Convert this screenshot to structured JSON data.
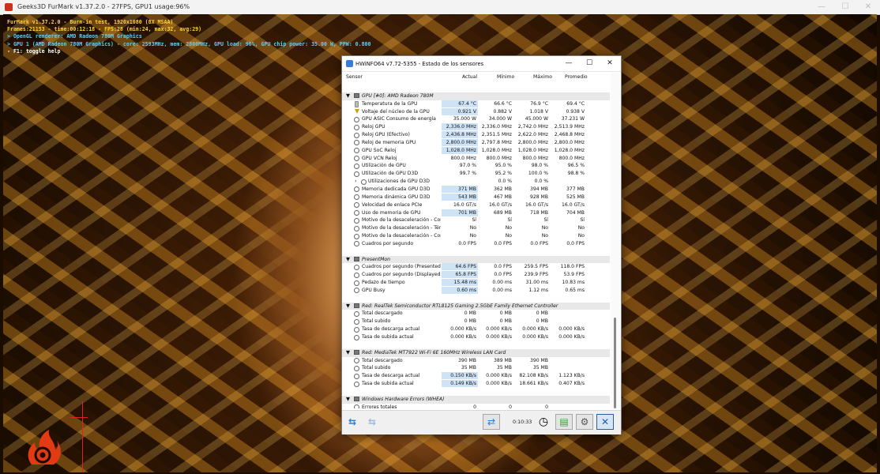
{
  "furmark": {
    "window_title": "Geeks3D FurMark v1.37.2.0 - 27FPS, GPU1 usage:96%",
    "overlay": {
      "line1": "FurMark v1.37.2.0 - Burn-in test, 1920x1080 (8X MSAA)",
      "line2": "Frames:21153 - time:00:12:18 - FPS:28 (min:24, max:32, avg:29)",
      "line3": "> OpenGL renderer: AMD Radeon 780M Graphics",
      "line4": "> GPU 1 (AMD Radeon 780M Graphics) - core: 2593MHz, mem: 2800MHz, GPU load: 96%, GPU chip power: 35.00 W, PPW: 0.800",
      "line5": "- F1: toggle help"
    },
    "window_buttons": {
      "minimize": "—",
      "maximize": "☐",
      "close": "✕"
    },
    "colors": {
      "overlay_yellow": "#ffd23a",
      "overlay_cyan": "#54d3ff"
    }
  },
  "hwinfo": {
    "window_title": "HWiNFO64 v7.72-5355 - Estado de los sensores",
    "window_buttons": {
      "minimize": "—",
      "maximize": "☐",
      "close": "✕"
    },
    "columns": {
      "sensor": "Sensor",
      "current": "Actual",
      "min": "Mínimo",
      "max": "Máximo",
      "avg": "Promedio"
    },
    "groups": {
      "gpu": {
        "title": "GPU [#0]: AMD Radeon 780M",
        "rows": [
          {
            "label": "Temperatura de la GPU",
            "cur": "67.4 °C",
            "min": "66.6 °C",
            "max": "76.9 °C",
            "avg": "69.4 °C"
          },
          {
            "label": "Voltaje del núcleo de la GPU",
            "cur": "0.921 V",
            "min": "0.882 V",
            "max": "1.018 V",
            "avg": "0.938 V"
          },
          {
            "label": "GPU ASIC Consumo de energía",
            "cur": "35.000 W",
            "min": "34.000 W",
            "max": "45.000 W",
            "avg": "37.231 W"
          },
          {
            "label": "Reloj GPU",
            "cur": "2,336.0 MHz",
            "min": "2,336.0 MHz",
            "max": "2,742.0 MHz",
            "avg": "2,513.9 MHz"
          },
          {
            "label": "Reloj GPU (Efectivo)",
            "cur": "2,436.8 MHz",
            "min": "2,351.5 MHz",
            "max": "2,622.0 MHz",
            "avg": "2,468.8 MHz"
          },
          {
            "label": "Reloj de memoria GPU",
            "cur": "2,800.0 MHz",
            "min": "2,797.8 MHz",
            "max": "2,800.0 MHz",
            "avg": "2,800.0 MHz"
          },
          {
            "label": "GPU SoC Reloj",
            "cur": "1,028.0 MHz",
            "min": "1,028.0 MHz",
            "max": "1,028.0 MHz",
            "avg": "1,028.0 MHz"
          },
          {
            "label": "GPU VCN Reloj",
            "cur": "800.0 MHz",
            "min": "800.0 MHz",
            "max": "800.0 MHz",
            "avg": "800.0 MHz"
          },
          {
            "label": "Utilización de GPU",
            "cur": "97.0 %",
            "min": "95.0 %",
            "max": "98.0 %",
            "avg": "96.5 %"
          },
          {
            "label": "Utilización de GPU D3D",
            "cur": "99.7 %",
            "min": "95.2 %",
            "max": "100.0 %",
            "avg": "98.8 %"
          },
          {
            "label": "Utilizaciones de GPU D3D",
            "cur": "",
            "min": "0.0 %",
            "max": "0.0 %",
            "avg": ""
          },
          {
            "label": "Memoria dedicada GPU D3D",
            "cur": "371 MB",
            "min": "362 MB",
            "max": "394 MB",
            "avg": "377 MB"
          },
          {
            "label": "Memoria dinámica GPU D3D",
            "cur": "543 MB",
            "min": "467 MB",
            "max": "928 MB",
            "avg": "525 MB"
          },
          {
            "label": "Velocidad de enlace PCIe",
            "cur": "16.0 GT/s",
            "min": "16.0 GT/s",
            "max": "16.0 GT/s",
            "avg": "16.0 GT/s"
          },
          {
            "label": "Uso de memoria de GPU",
            "cur": "701 MB",
            "min": "689 MB",
            "max": "718 MB",
            "avg": "704 MB"
          },
          {
            "label": "Motivo de la desaceleración - Con...",
            "cur": "Sí",
            "min": "Sí",
            "max": "Sí",
            "avg": "Sí"
          },
          {
            "label": "Motivo de la desaceleración - Tér...",
            "cur": "No",
            "min": "No",
            "max": "No",
            "avg": "No"
          },
          {
            "label": "Motivo de la desaceleración - Cor...",
            "cur": "No",
            "min": "No",
            "max": "No",
            "avg": "No"
          },
          {
            "label": "Cuadros por segundo",
            "cur": "0.0 FPS",
            "min": "0.0 FPS",
            "max": "0.0 FPS",
            "avg": "0.0 FPS"
          }
        ]
      },
      "presentmon": {
        "title": "PresentMon",
        "rows": [
          {
            "label": "Cuadros por segundo (Presented)",
            "cur": "64.6 FPS",
            "min": "0.0 FPS",
            "max": "259.5 FPS",
            "avg": "118.0 FPS"
          },
          {
            "label": "Cuadros por segundo (Displayed)",
            "cur": "65.8 FPS",
            "min": "0.0 FPS",
            "max": "239.9 FPS",
            "avg": "53.9 FPS"
          },
          {
            "label": "Pedazo de tiempo",
            "cur": "15.48 ms",
            "min": "0.00 ms",
            "max": "31.00 ms",
            "avg": "10.83 ms"
          },
          {
            "label": "GPU Busy",
            "cur": "0.60 ms",
            "min": "0.00 ms",
            "max": "1.12 ms",
            "avg": "0.65 ms"
          }
        ]
      },
      "ethernet": {
        "title": "Red: RealTek Semiconductor RTL8125 Gaming 2.5GbE Family Ethernet Controller",
        "rows": [
          {
            "label": "Total descargado",
            "cur": "0 MB",
            "min": "0 MB",
            "max": "0 MB",
            "avg": ""
          },
          {
            "label": "Total subido",
            "cur": "0 MB",
            "min": "0 MB",
            "max": "0 MB",
            "avg": ""
          },
          {
            "label": "Tasa de descarga actual",
            "cur": "0.000 KB/s",
            "min": "0.000 KB/s",
            "max": "0.000 KB/s",
            "avg": "0.000 KB/s"
          },
          {
            "label": "Tasa de subida actual",
            "cur": "0.000 KB/s",
            "min": "0.000 KB/s",
            "max": "0.000 KB/s",
            "avg": "0.000 KB/s"
          }
        ]
      },
      "wifi": {
        "title": "Red: MediaTek MT7922 Wi-Fi 6E 160MHz Wireless LAN Card",
        "rows": [
          {
            "label": "Total descargado",
            "cur": "390 MB",
            "min": "389 MB",
            "max": "390 MB",
            "avg": ""
          },
          {
            "label": "Total subido",
            "cur": "35 MB",
            "min": "35 MB",
            "max": "35 MB",
            "avg": ""
          },
          {
            "label": "Tasa de descarga actual",
            "cur": "0.150 KB/s",
            "min": "0.000 KB/s",
            "max": "82.108 KB/s",
            "avg": "1.123 KB/s"
          },
          {
            "label": "Tasa de subida actual",
            "cur": "0.149 KB/s",
            "min": "0.000 KB/s",
            "max": "18.661 KB/s",
            "avg": "0.407 KB/s"
          }
        ]
      },
      "whea": {
        "title": "Windows Hardware Errors (WHEA)",
        "rows": [
          {
            "label": "Errores totales",
            "cur": "0",
            "min": "0",
            "max": "0",
            "avg": ""
          }
        ]
      }
    },
    "footer": {
      "timer": "0:10:33",
      "nav_left_icon": "double-arrow-left-icon",
      "nav_right_icon": "double-arrow-right-icon",
      "network_icon": "network-icon",
      "clock_icon": "clock-icon",
      "report_icon": "report-icon",
      "settings_icon": "gear-icon",
      "close_icon": "close-icon"
    },
    "colors": {
      "current_highlight": "#cfe3f7",
      "group_bg": "#e8e8e8",
      "accent": "#2f7fd6"
    }
  }
}
